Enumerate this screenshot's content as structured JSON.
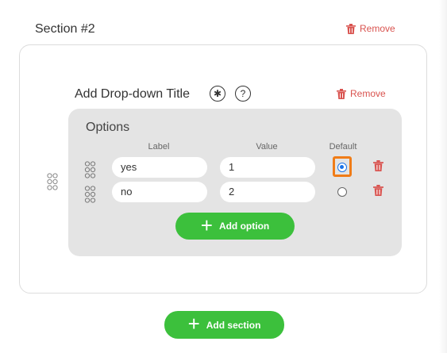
{
  "section": {
    "title": "Section #2",
    "remove_label": "Remove"
  },
  "dropdown": {
    "title": "Add Drop-down Title",
    "required_icon": "asterisk",
    "help_icon": "question",
    "remove_label": "Remove"
  },
  "options": {
    "title": "Options",
    "columns": {
      "label": "Label",
      "value": "Value",
      "default": "Default"
    },
    "rows": [
      {
        "label": "yes",
        "value": "1",
        "default": true
      },
      {
        "label": "no",
        "value": "2",
        "default": false
      }
    ],
    "add_option_label": "Add option"
  },
  "add_section_label": "Add section",
  "colors": {
    "accent_green": "#3cc03c",
    "remove_red": "#d9534f",
    "highlight_orange": "#f07c17",
    "radio_blue": "#1a73e8"
  }
}
